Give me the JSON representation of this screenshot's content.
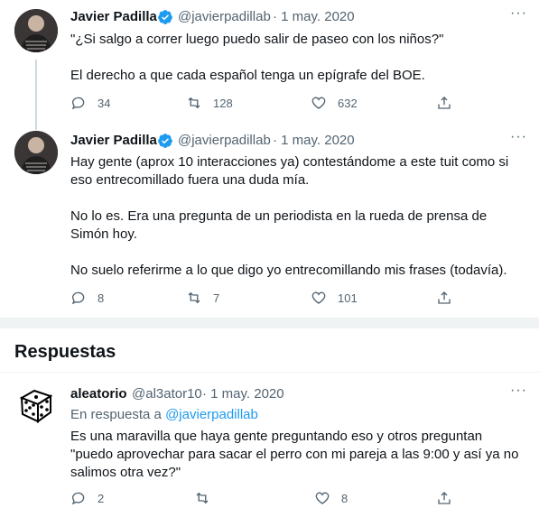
{
  "tweets": [
    {
      "name": "Javier Padilla",
      "handle": "@javierpadillab",
      "time": "· 1 may. 2020",
      "text": "\"¿Si salgo a correr luego puedo salir de paseo con los niños?\"\n\nEl derecho a que cada español tenga un epígrafe del BOE.",
      "replies": "34",
      "retweets": "128",
      "likes": "632"
    },
    {
      "name": "Javier Padilla",
      "handle": "@javierpadillab",
      "time": "· 1 may. 2020",
      "text": "Hay gente (aprox 10 interacciones ya) contestándome a este tuit como si eso entrecomillado fuera una duda mía.\n\nNo lo es. Era una pregunta de un periodista en la rueda de prensa de Simón hoy.\n\nNo suelo referirme a lo que digo yo entrecomillando mis frases (todavía).",
      "replies": "8",
      "retweets": "7",
      "likes": "101"
    }
  ],
  "section_title": "Respuestas",
  "reply": {
    "name": "aleatorio",
    "handle": "@al3ator10",
    "time": "· 1 may. 2020",
    "reply_prefix": "En respuesta a ",
    "reply_target": "@javierpadillab",
    "text": "Es una maravilla que haya gente preguntando eso y otros preguntan \"puedo aprovechar para sacar el perro con mi pareja a las 9:00 y así ya no salimos otra vez?\"",
    "replies": "2",
    "retweets": "",
    "likes": "8"
  },
  "colors": {
    "accent": "#1d9bf0",
    "muted": "#536471",
    "text": "#0f1419"
  },
  "icons": [
    "reply-icon",
    "retweet-icon",
    "like-icon",
    "share-icon",
    "more-icon",
    "verified-badge-icon"
  ]
}
